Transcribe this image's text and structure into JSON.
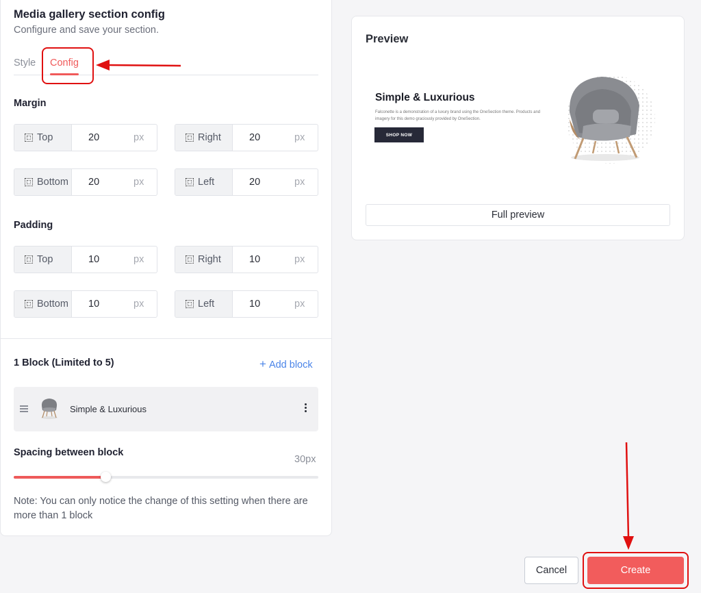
{
  "section": {
    "title": "Media gallery section config",
    "subtitle": "Configure and save your section."
  },
  "tabs": [
    {
      "label": "Style",
      "active": false
    },
    {
      "label": "Config",
      "active": true
    }
  ],
  "margin": {
    "label": "Margin",
    "fields": [
      {
        "side": "Top",
        "value": "20",
        "unit": "px"
      },
      {
        "side": "Right",
        "value": "20",
        "unit": "px"
      },
      {
        "side": "Bottom",
        "value": "20",
        "unit": "px"
      },
      {
        "side": "Left",
        "value": "20",
        "unit": "px"
      }
    ]
  },
  "padding": {
    "label": "Padding",
    "fields": [
      {
        "side": "Top",
        "value": "10",
        "unit": "px"
      },
      {
        "side": "Right",
        "value": "10",
        "unit": "px"
      },
      {
        "side": "Bottom",
        "value": "10",
        "unit": "px"
      },
      {
        "side": "Left",
        "value": "10",
        "unit": "px"
      }
    ]
  },
  "blocks": {
    "title": "1 Block (Limited to 5)",
    "add_label": "Add block",
    "items": [
      {
        "name": "Simple & Luxurious"
      }
    ]
  },
  "spacing": {
    "label": "Spacing between block",
    "value_label": "30px",
    "fraction": 0.3
  },
  "note": "Note: You can only notice the change of this setting when there are more than 1 block",
  "preview": {
    "title": "Preview",
    "banner_title": "Simple & Luxurious",
    "banner_desc": "Falconette is a demonstration of a luxury brand using the OneSection theme. Products and imagery for this demo graciously provided by OneSection.",
    "shop_label": "SHOP NOW",
    "full_preview_label": "Full preview"
  },
  "footer": {
    "cancel_label": "Cancel",
    "create_label": "Create"
  },
  "colors": {
    "accent": "#f25c5c",
    "link": "#4a84e8",
    "annotation": "#e01010"
  }
}
